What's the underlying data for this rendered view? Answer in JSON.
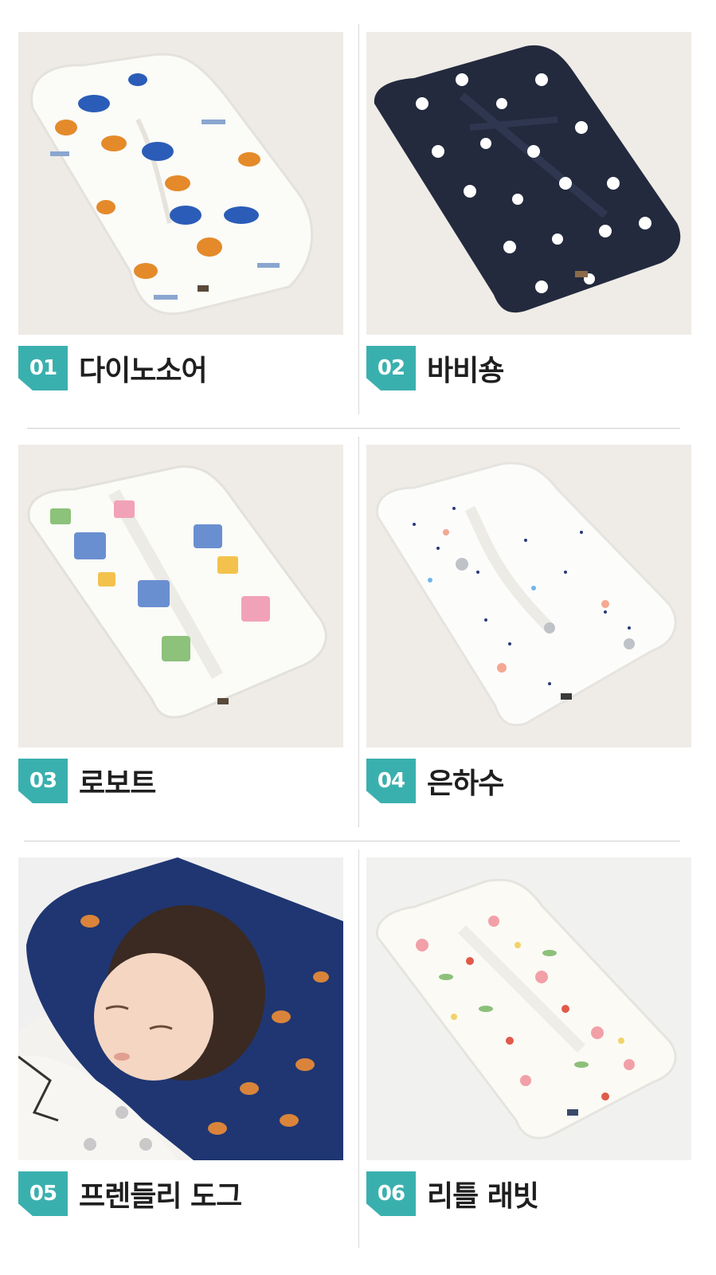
{
  "products": [
    {
      "number": "01",
      "name": "다이노소어",
      "pattern": "dinosaur",
      "fabric_color": "#fbfbf8",
      "accent_colors": [
        "#e48a2a",
        "#2b5cb8",
        "#8aa6cf"
      ]
    },
    {
      "number": "02",
      "name": "바비숑",
      "pattern": "bichon-dog",
      "fabric_color": "#232a3e",
      "accent_colors": [
        "#ffffff",
        "#e0443c",
        "#7cae4a"
      ]
    },
    {
      "number": "03",
      "name": "로보트",
      "pattern": "robot",
      "fabric_color": "#fbfbf7",
      "accent_colors": [
        "#6a8fd0",
        "#f2a2b8",
        "#8cc27a",
        "#f3c24d"
      ]
    },
    {
      "number": "04",
      "name": "은하수",
      "pattern": "milky-way-dots",
      "fabric_color": "#fcfcfb",
      "accent_colors": [
        "#2a3a7a",
        "#f4a892",
        "#bfc3c8",
        "#6fb6e8"
      ]
    },
    {
      "number": "05",
      "name": "프렌들리 도그",
      "pattern": "friendly-dog",
      "fabric_color": "#1f3672",
      "accent_colors": [
        "#d9843a",
        "#ffffff"
      ]
    },
    {
      "number": "06",
      "name": "리틀 래빗",
      "pattern": "little-rabbit-floral",
      "fabric_color": "#fbfaf5",
      "accent_colors": [
        "#f2a0a8",
        "#e05a4a",
        "#8cc07a",
        "#f1d36a"
      ]
    }
  ],
  "colors": {
    "badge": "#3ab0ae",
    "divider": "#d4d4d4",
    "rug": "#efede9"
  }
}
